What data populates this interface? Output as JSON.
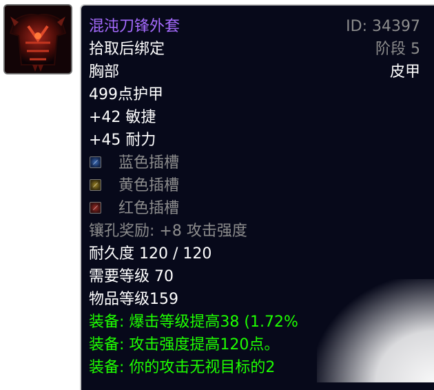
{
  "item": {
    "icon": "chest-armor-icon",
    "name": "混沌刀锋外套",
    "id_text": "ID: 34397",
    "bind": "拾取后绑定",
    "tier": "阶段 5",
    "slot": "胸部",
    "armor_type": "皮甲",
    "armor_value": "499点护甲",
    "stat_agility": "+42 敏捷",
    "stat_stamina": "+45 耐力",
    "sockets": [
      {
        "color": "blue",
        "label": "蓝色插槽"
      },
      {
        "color": "yellow",
        "label": "黄色插槽"
      },
      {
        "color": "red",
        "label": "红色插槽"
      }
    ],
    "socket_bonus": "镶孔奖励: +8 攻击强度",
    "durability": "耐久度 120 / 120",
    "required_level": "需要等级 70",
    "item_level": "物品等级159",
    "equip_effects": [
      "装备:  爆击等级提高38 (1.72%",
      "装备:  攻击强度提高120点。",
      "装备:  你的攻击无视目标的2"
    ]
  },
  "colors": {
    "epic_name": "#a66bff",
    "equip_green": "#1eff00",
    "grey_text": "#8d8d8d",
    "tooltip_bg": "#07091a"
  }
}
